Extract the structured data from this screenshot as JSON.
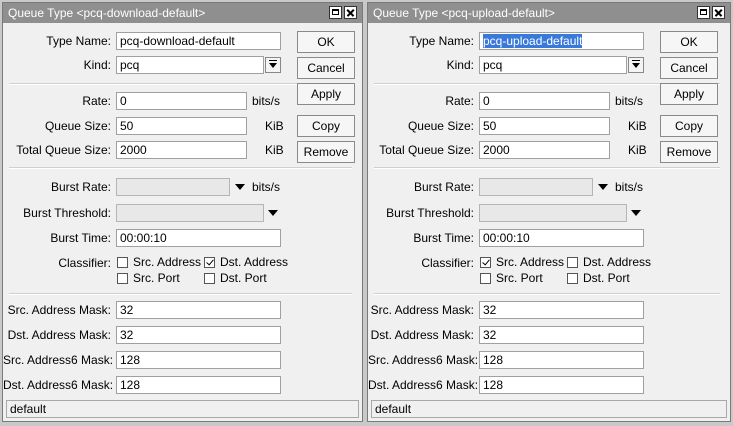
{
  "left": {
    "title": "Queue Type <pcq-download-default>",
    "type_name_label": "Type Name:",
    "type_name": "pcq-download-default",
    "kind_label": "Kind:",
    "kind": "pcq",
    "rate_label": "Rate:",
    "rate": "0",
    "rate_unit": "bits/s",
    "queue_size_label": "Queue Size:",
    "queue_size": "50",
    "queue_size_unit": "KiB",
    "total_queue_size_label": "Total Queue Size:",
    "total_queue_size": "2000",
    "total_queue_size_unit": "KiB",
    "burst_rate_label": "Burst Rate:",
    "burst_rate_unit": "bits/s",
    "burst_threshold_label": "Burst Threshold:",
    "burst_time_label": "Burst Time:",
    "burst_time": "00:00:10",
    "classifier_label": "Classifier:",
    "classifier": {
      "src_address": {
        "label": "Src. Address",
        "checked": false
      },
      "dst_address": {
        "label": "Dst. Address",
        "checked": true
      },
      "src_port": {
        "label": "Src. Port",
        "checked": false
      },
      "dst_port": {
        "label": "Dst. Port",
        "checked": false
      }
    },
    "src_address_mask_label": "Src. Address Mask:",
    "src_address_mask": "32",
    "dst_address_mask_label": "Dst. Address Mask:",
    "dst_address_mask": "32",
    "src_address6_mask_label": "Src. Address6 Mask:",
    "src_address6_mask": "128",
    "dst_address6_mask_label": "Dst. Address6 Mask:",
    "dst_address6_mask": "128",
    "buttons": {
      "ok": "OK",
      "cancel": "Cancel",
      "apply": "Apply",
      "copy": "Copy",
      "remove": "Remove"
    },
    "status": "default"
  },
  "right": {
    "title": "Queue Type <pcq-upload-default>",
    "type_name_label": "Type Name:",
    "type_name": "pcq-upload-default",
    "kind_label": "Kind:",
    "kind": "pcq",
    "rate_label": "Rate:",
    "rate": "0",
    "rate_unit": "bits/s",
    "queue_size_label": "Queue Size:",
    "queue_size": "50",
    "queue_size_unit": "KiB",
    "total_queue_size_label": "Total Queue Size:",
    "total_queue_size": "2000",
    "total_queue_size_unit": "KiB",
    "burst_rate_label": "Burst Rate:",
    "burst_rate_unit": "bits/s",
    "burst_threshold_label": "Burst Threshold:",
    "burst_time_label": "Burst Time:",
    "burst_time": "00:00:10",
    "classifier_label": "Classifier:",
    "classifier": {
      "src_address": {
        "label": "Src. Address",
        "checked": true
      },
      "dst_address": {
        "label": "Dst. Address",
        "checked": false
      },
      "src_port": {
        "label": "Src. Port",
        "checked": false
      },
      "dst_port": {
        "label": "Dst. Port",
        "checked": false
      }
    },
    "src_address_mask_label": "Src. Address Mask:",
    "src_address_mask": "32",
    "dst_address_mask_label": "Dst. Address Mask:",
    "dst_address_mask": "32",
    "src_address6_mask_label": "Src. Address6 Mask:",
    "src_address6_mask": "128",
    "dst_address6_mask_label": "Dst. Address6 Mask:",
    "dst_address6_mask": "128",
    "buttons": {
      "ok": "OK",
      "cancel": "Cancel",
      "apply": "Apply",
      "copy": "Copy",
      "remove": "Remove"
    },
    "status": "default"
  }
}
